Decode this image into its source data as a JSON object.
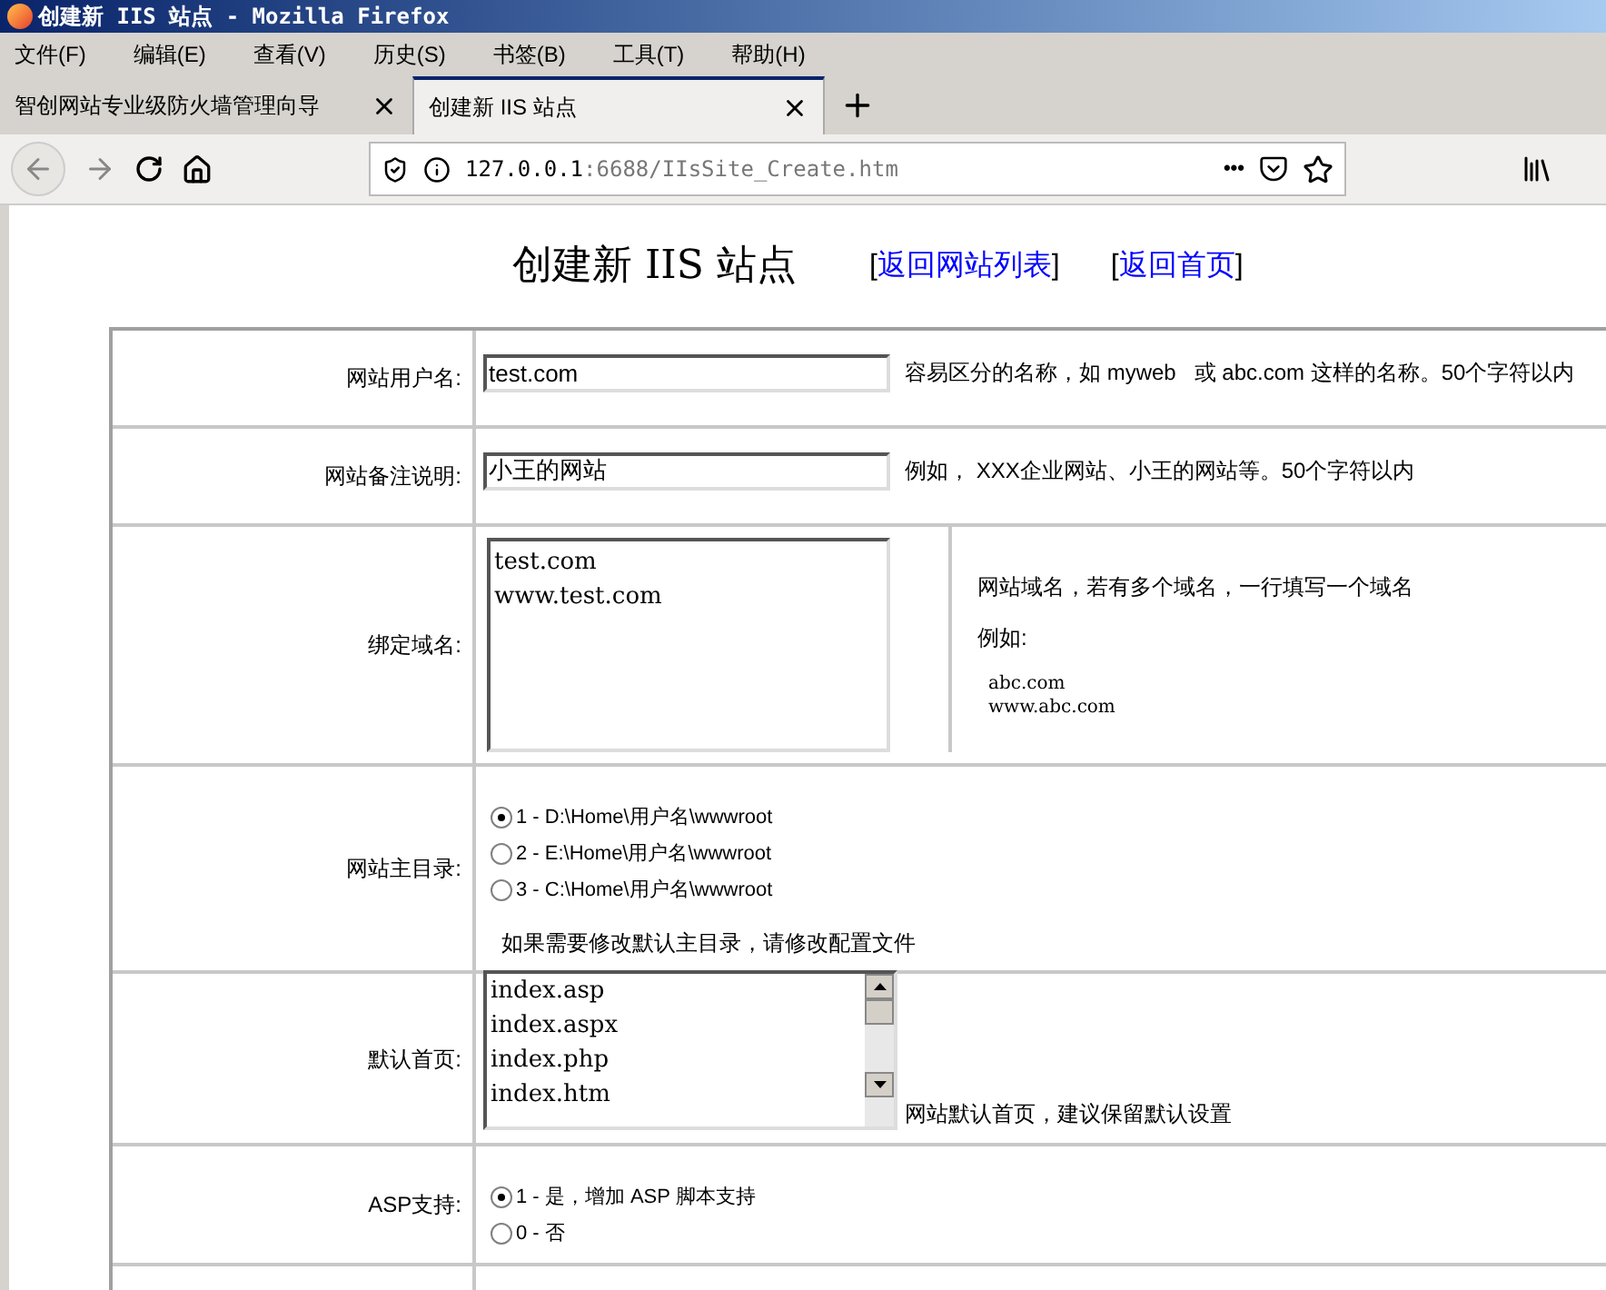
{
  "window": {
    "title": "创建新 IIS 站点 - Mozilla Firefox"
  },
  "menu": [
    "文件(F)",
    "编辑(E)",
    "查看(V)",
    "历史(S)",
    "书签(B)",
    "工具(T)",
    "帮助(H)"
  ],
  "tabs": [
    {
      "label": "智创网站专业级防火墙管理向导",
      "selected": false
    },
    {
      "label": "创建新 IIS 站点",
      "selected": true
    }
  ],
  "address": {
    "host": "127.0.0.1",
    "rest": ":6688/IIsSite_Create.htm",
    "more": "•••"
  },
  "page": {
    "title": "创建新 IIS 站点",
    "links": [
      {
        "before": "[",
        "label": "返回网站列表",
        "after": "]"
      },
      {
        "before": "[",
        "label": "返回首页",
        "after": "]"
      }
    ]
  },
  "rows": [
    {
      "kind": "input",
      "label": "网站用户名:",
      "value": "test.com",
      "hint": "容易区分的名称，如 myweb   或 abc.com 这样的名称。50个字符以内"
    },
    {
      "kind": "input",
      "label": "网站备注说明:",
      "value": "小王的网站",
      "hint": "例如， XXX企业网站、小王的网站等。50个字符以内"
    },
    {
      "kind": "domains",
      "label": "绑定域名:",
      "lines": [
        "test.com",
        "www.test.com"
      ],
      "hint": "网站域名，若有多个域名，一行填写一个域名",
      "example_label": "例如:",
      "examples": [
        "abc.com",
        "www.abc.com"
      ]
    },
    {
      "kind": "radio",
      "label": "网站主目录:",
      "options": [
        {
          "text": "1 - D:\\Home\\用户名\\wwwroot",
          "selected": true
        },
        {
          "text": "2 - E:\\Home\\用户名\\wwwroot",
          "selected": false
        },
        {
          "text": "3 - C:\\Home\\用户名\\wwwroot",
          "selected": false
        }
      ],
      "note": "如果需要修改默认主目录，请修改配置文件"
    },
    {
      "kind": "listbox",
      "label": "默认首页:",
      "items": [
        "index.asp",
        "index.aspx",
        "index.php",
        "index.htm"
      ],
      "hint": "网站默认首页，建议保留默认设置"
    },
    {
      "kind": "radio",
      "label": "ASP支持:",
      "options": [
        {
          "text": "1 - 是，增加 ASP 脚本支持",
          "selected": true
        },
        {
          "text": "0 - 否",
          "selected": false
        }
      ]
    }
  ]
}
